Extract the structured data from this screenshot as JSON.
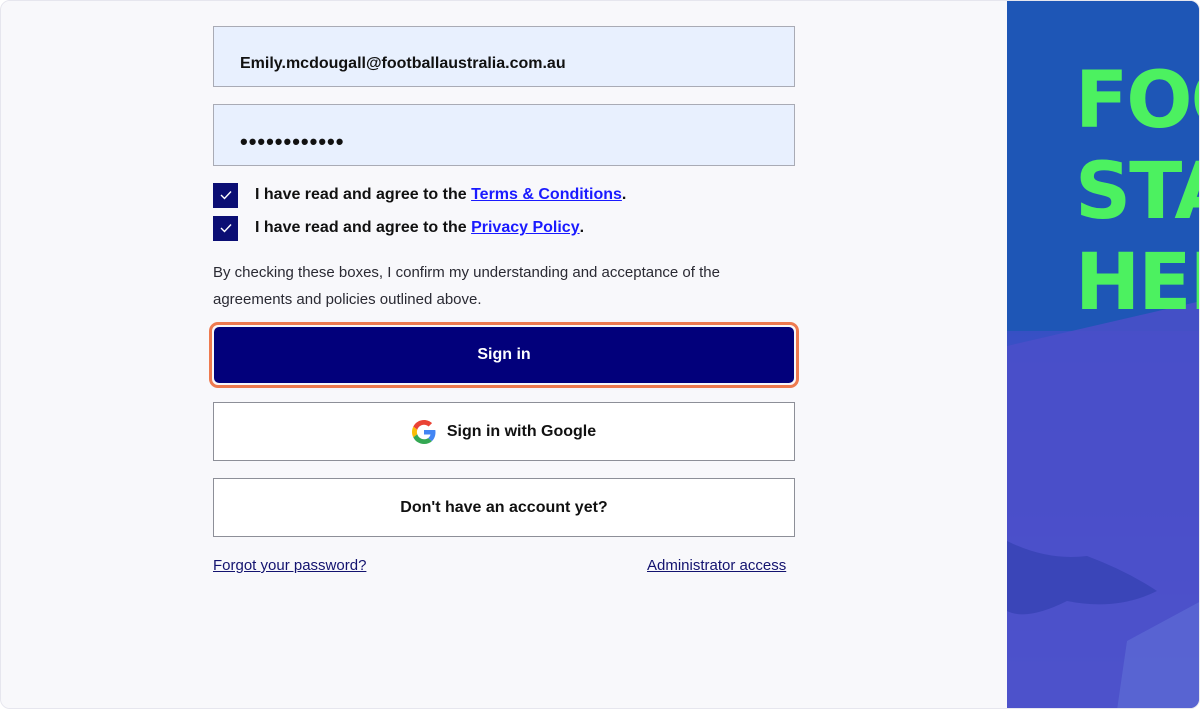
{
  "form": {
    "email_value": "Emily.mcdougall@footballaustralia.com.au",
    "password_value": "••••••••••••",
    "terms": {
      "prefix": "I have read and agree to the ",
      "link": "Terms & Conditions",
      "suffix": ".",
      "checked": true
    },
    "privacy": {
      "prefix": "I have read and agree to the ",
      "link": "Privacy Policy",
      "suffix": ".",
      "checked": true
    },
    "consent_note": "By checking these boxes, I confirm my understanding and acceptance of the agreements and policies outlined above.",
    "sign_in_label": "Sign in",
    "google_label": "Sign in with Google",
    "no_account_label": "Don't have an account yet?",
    "forgot_label": "Forgot your password?",
    "admin_label": "Administrator access"
  },
  "hero": {
    "lines": [
      "FOO",
      "STA",
      "HEI"
    ]
  },
  "colors": {
    "primary_button": "#02007b",
    "checkbox": "#0b0e74",
    "focus_ring": "#ee7a4f",
    "hero_text": "#4cf160",
    "input_bg": "#e8f0fe"
  },
  "icons": {
    "checkbox_mark": "check-icon",
    "google": "google-logo-icon"
  }
}
